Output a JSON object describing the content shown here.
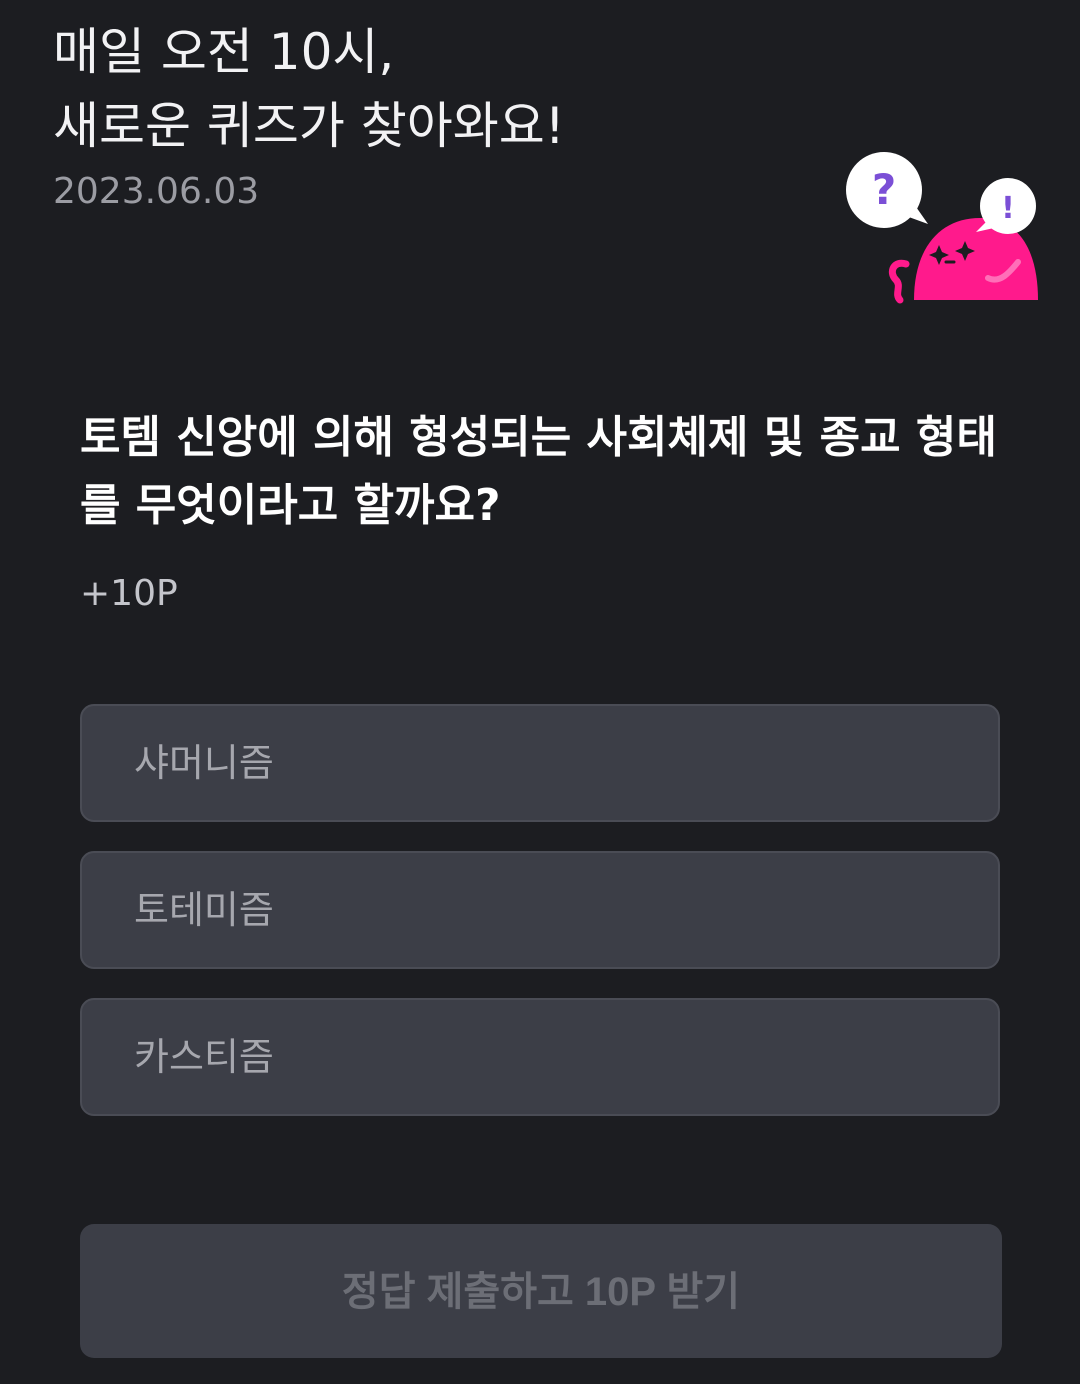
{
  "header": {
    "line1": "매일 오전 10시,",
    "line2": "새로운 퀴즈가 찾아와요!",
    "date": "2023.06.03"
  },
  "quiz": {
    "question": "토템 신앙에 의해 형성되는 사회체제 및 종교 형태를 무엇이라고 할까요?",
    "points": "+10P",
    "options": [
      {
        "label": "샤머니즘"
      },
      {
        "label": "토테미즘"
      },
      {
        "label": "카스티즘"
      }
    ]
  },
  "submit": {
    "label": "정답 제출하고 10P 받기",
    "enabled": false
  },
  "mascot": {
    "icon": "quiz-character-icon",
    "bubble1_glyph": "?",
    "bubble2_glyph": "!",
    "body_color": "#ff1a8c",
    "glyph_color": "#7b4fd6"
  },
  "colors": {
    "background": "#1c1d21",
    "option_background": "#3c3e47",
    "button_text_disabled": "#6c6e76"
  }
}
